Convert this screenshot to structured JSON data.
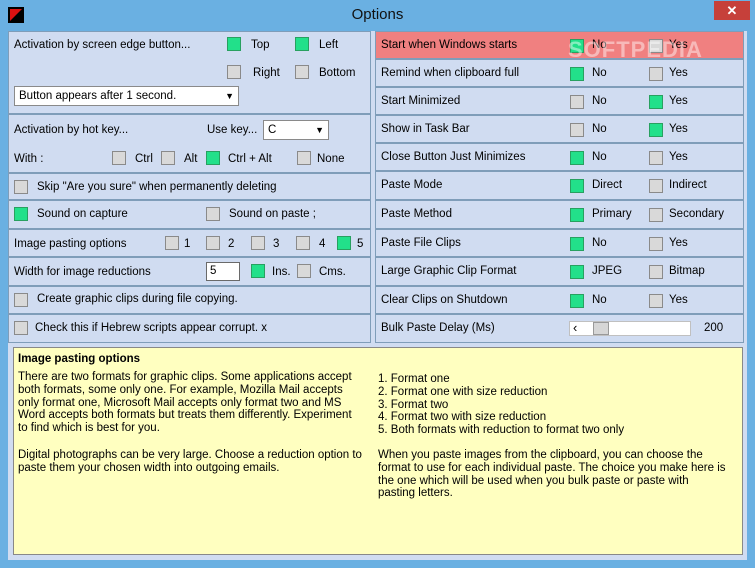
{
  "window": {
    "title": "Options",
    "close": "✕"
  },
  "left": {
    "edge": {
      "label": "Activation by screen edge button...",
      "top": "Top",
      "left": "Left",
      "right": "Right",
      "bottom": "Bottom",
      "select_value": "Button appears after 1 second."
    },
    "hotkey": {
      "label": "Activation by hot key...",
      "use_key": "Use key...",
      "key_value": "C",
      "with_label": "With  :",
      "ctrl": "Ctrl",
      "alt": "Alt",
      "ctrl_alt": "Ctrl + Alt",
      "none": "None"
    },
    "skip": "Skip \"Are you sure\" when permanently deleting",
    "sound_capture": "Sound on capture",
    "sound_paste": "Sound on paste ;",
    "image_opts": {
      "label": "Image pasting options",
      "o1": "1",
      "o2": "2",
      "o3": "3",
      "o4": "4",
      "o5": "5"
    },
    "width": {
      "label": "Width for image reductions",
      "value": "5",
      "ins": "Ins.",
      "cms": "Cms."
    },
    "graphic_clips": "Create graphic clips during file copying.",
    "hebrew": "Check this if Hebrew scripts appear corrupt. x"
  },
  "right": {
    "rows": [
      {
        "label": "Start when Windows starts",
        "a": "No",
        "b": "Yes"
      },
      {
        "label": "Remind when clipboard full",
        "a": "No",
        "b": "Yes"
      },
      {
        "label": "Start Minimized",
        "a": "No",
        "b": "Yes"
      },
      {
        "label": "Show in Task Bar",
        "a": "No",
        "b": "Yes"
      },
      {
        "label": "Close Button Just Minimizes",
        "a": "No",
        "b": "Yes"
      },
      {
        "label": "Paste Mode",
        "a": "Direct",
        "b": "Indirect"
      },
      {
        "label": "Paste Method",
        "a": "Primary",
        "b": "Secondary"
      },
      {
        "label": "Paste File Clips",
        "a": "No",
        "b": "Yes"
      },
      {
        "label": "Large Graphic Clip Format",
        "a": "JPEG",
        "b": "Bitmap"
      },
      {
        "label": "Clear Clips on Shutdown",
        "a": "No",
        "b": "Yes"
      }
    ],
    "bulk": {
      "label": "Bulk Paste Delay (Ms)",
      "value": "200",
      "left_arrow": "‹"
    },
    "watermark": "SOFTPEDIA"
  },
  "help": {
    "title": "Image pasting options",
    "left_p1": "There are two formats for graphic clips. Some applications accept both formats, some only one. For example, Mozilla Mail accepts only format one, Microsoft Mail accepts only format two and MS Word accepts both formats but treats them differently. Experiment to find which is best for you.",
    "left_p2": "Digital photographs can be very large. Choose a reduction option to paste them your chosen width into outgoing emails.",
    "list": [
      "1. Format one",
      "2. Format one with size reduction",
      "3. Format two",
      "4. Format two with size reduction",
      "5. Both formats with reduction to format two only"
    ],
    "right_p": "When you paste images from the clipboard, you can choose the format to use for each individual paste. The choice you make here is the one which will be used when you bulk paste or paste with pasting letters."
  },
  "colors": {
    "accent_on": "#22e08a",
    "highlight_row": "#f08080",
    "titlebar": "#6ab0e2",
    "help_bg": "#ffffc0"
  }
}
